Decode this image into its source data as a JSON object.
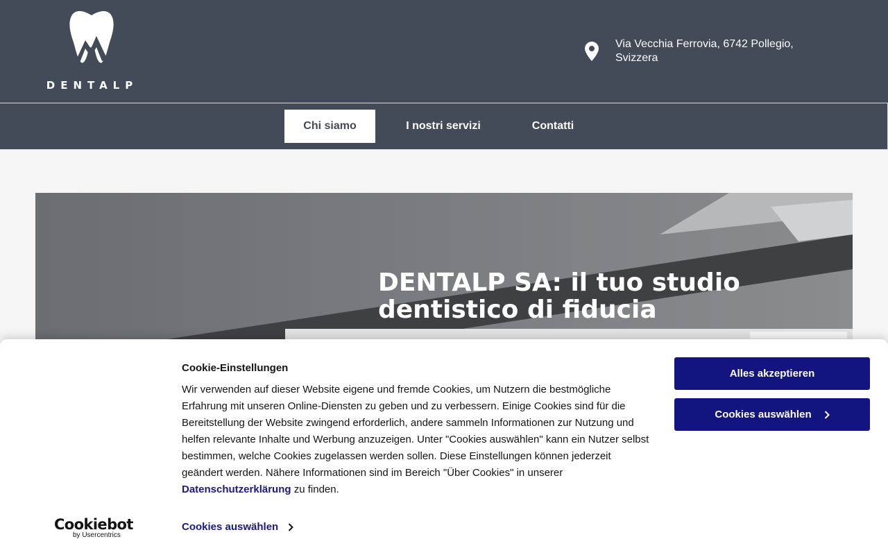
{
  "header": {
    "logo_text": "DENTALP",
    "address": "Via Vecchia Ferrovia, 6742 Pollegio, Svizzera"
  },
  "nav": {
    "items": [
      {
        "label": "Chi siamo",
        "active": true
      },
      {
        "label": "I nostri servizi",
        "active": false
      },
      {
        "label": "Contatti",
        "active": false
      }
    ]
  },
  "hero": {
    "title": "DENTALP SA: il tuo studio dentistico di fiducia"
  },
  "cookie": {
    "brand": "Cookiebot",
    "brand_sub": "by Usercentrics",
    "title": "Cookie-Einstellungen",
    "body_text": "Wir verwenden auf dieser Website eigene und fremde Cookies, um Nutzern die bestmögliche Erfahrung mit unseren Online-Diensten zu geben und zu verbessern. Einige Cookies sind für die Bereitstellung der Website zwingend erforderlich, andere sammeln Informationen zur Nutzung und helfen relevante Inhalte und Werbung anzuzeigen. Unter \"Cookies auswählen\" kann ein Nutzer selbst bestimmen, welche Cookies zugelassen werden sollen. Diese Einstellungen können jederzeit geändert werden. Nähere Informationen sind im Bereich \"Über Cookies\" in unserer",
    "privacy_link": "Datenschutzerklärung",
    "body_suffix": " zu finden.",
    "select_link": "Cookies auswählen",
    "accept_button": "Alles akzeptieren",
    "select_button": "Cookies auswählen"
  },
  "colors": {
    "header_bg": "#434a58",
    "button_bg": "#141481",
    "link": "#1a1a7e"
  }
}
